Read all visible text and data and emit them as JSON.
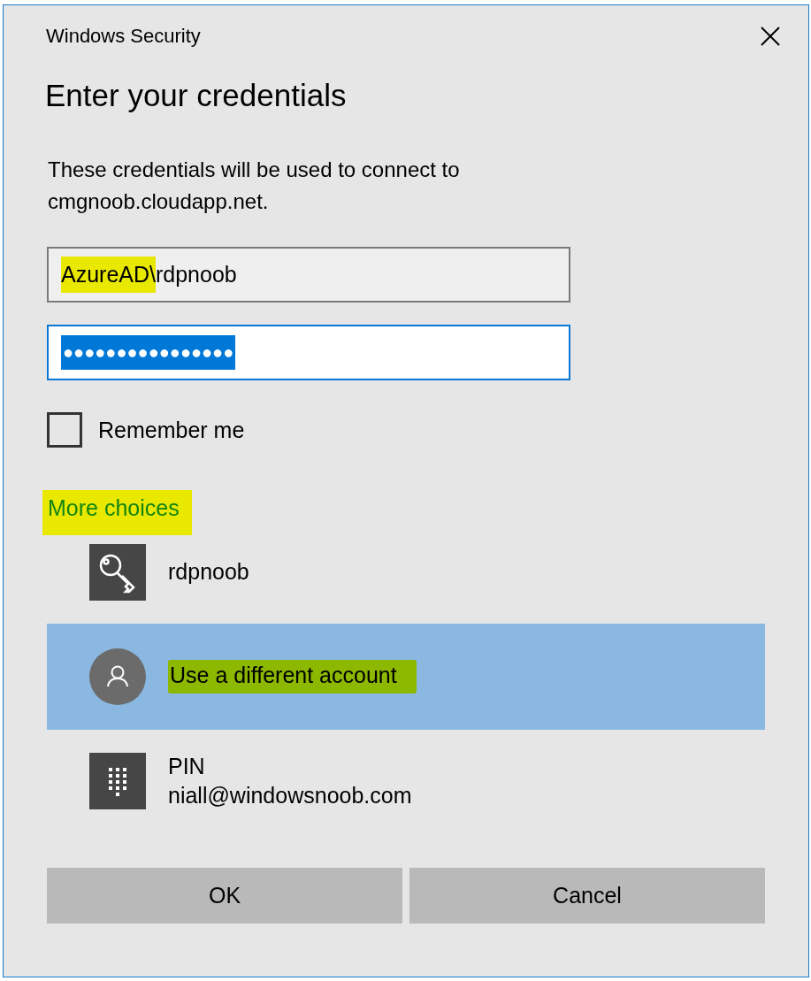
{
  "window": {
    "title": "Windows Security"
  },
  "heading": "Enter your credentials",
  "description": "These credentials will be used to connect to cmgnoob.cloudapp.net.",
  "username_field": {
    "value_parts": [
      {
        "text": "AzureAD\\",
        "color": "#e8e800"
      },
      {
        "text": "rdpnoob"
      }
    ],
    "focused": false
  },
  "password_field": {
    "value": "●●●●●●●●●●●●●●●●",
    "focused": true,
    "text_selected": true
  },
  "remember_me": {
    "label": "Remember me",
    "checked": false
  },
  "more_choices": {
    "label": "More choices",
    "color": "#e8e800"
  },
  "choices": [
    {
      "kind": "key",
      "lines": [
        "rdpnoob"
      ],
      "selected": false
    },
    {
      "kind": "user",
      "lines": [
        "Use a different account"
      ],
      "selected": true,
      "color": "#8cb800"
    },
    {
      "kind": "pin",
      "lines": [
        "PIN",
        "niall@windowsnoob.com"
      ],
      "selected": false
    }
  ],
  "buttons": [
    {
      "label": "OK"
    },
    {
      "label": "Cancel"
    }
  ]
}
